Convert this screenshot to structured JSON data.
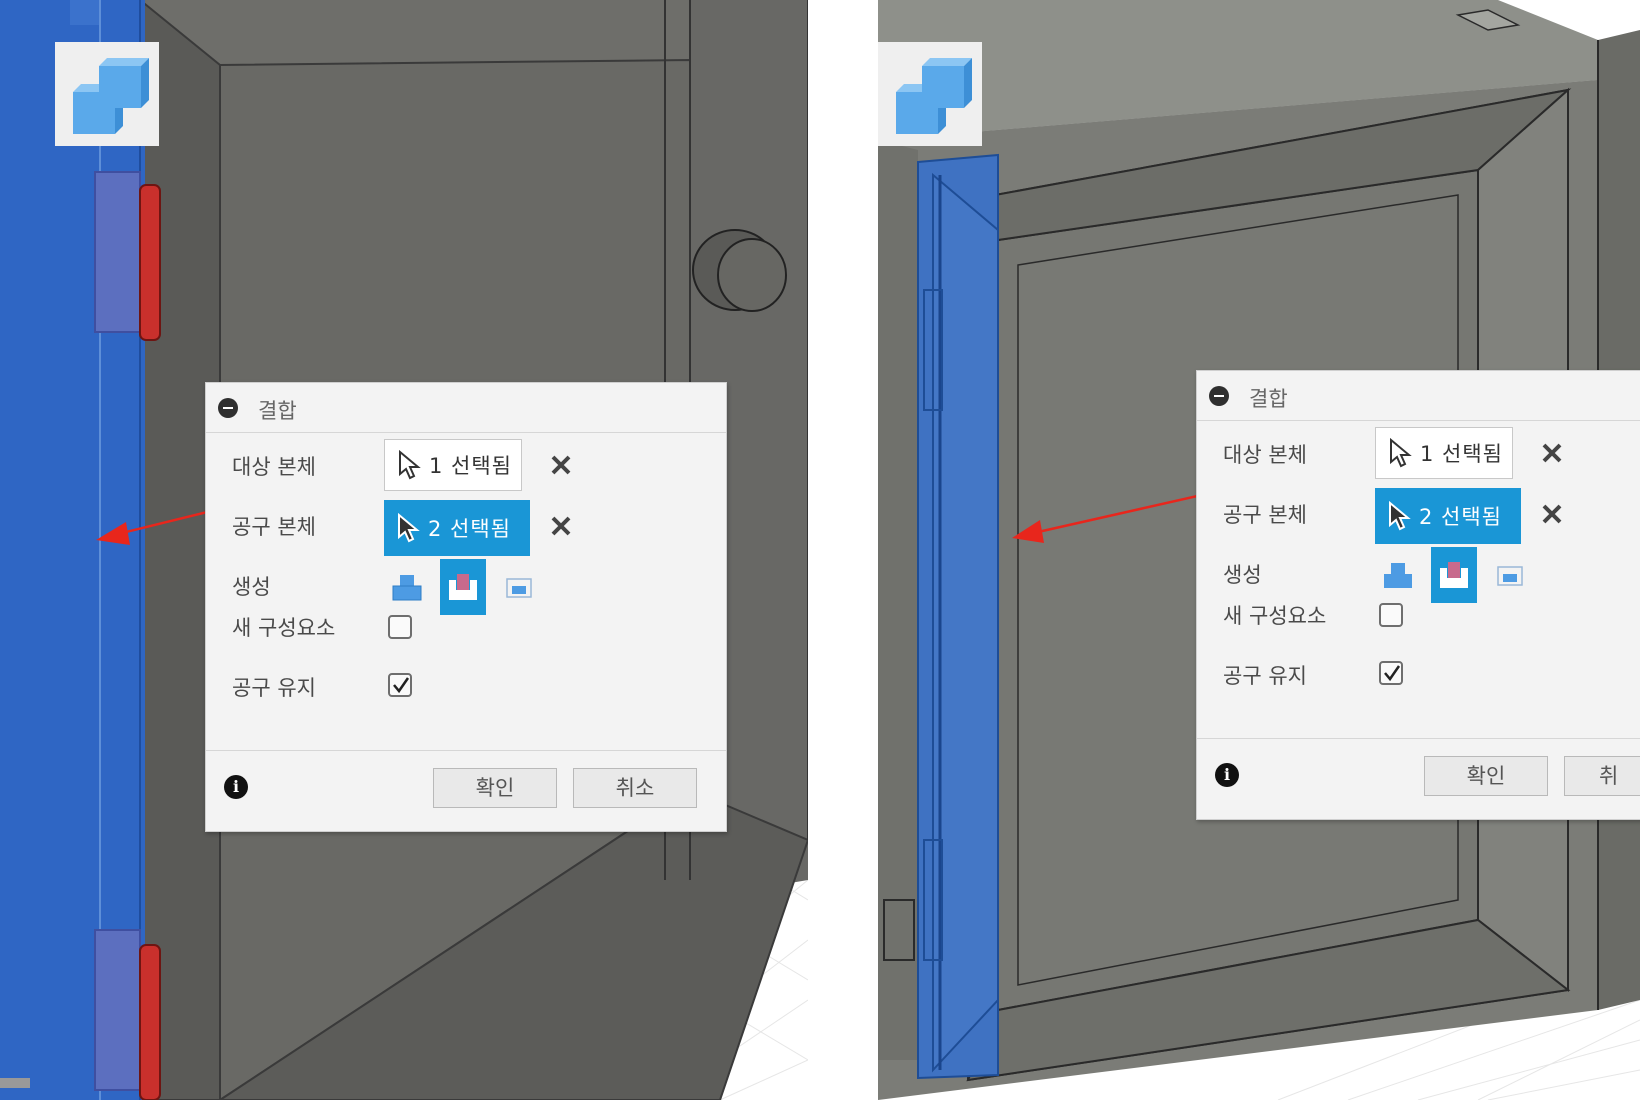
{
  "colors": {
    "accent": "#1a96d6",
    "selected_body": "#2f66c4",
    "arrow": "#e8261c",
    "hinge": "#c9302c",
    "door_gray": "#6b6b67"
  },
  "app_icon": {
    "name": "combine-tool-icon"
  },
  "dialogs": [
    {
      "title": "결합",
      "target_label": "대상 본체",
      "target_value": "1 선택됨",
      "tool_label": "공구 본체",
      "tool_value": "2 선택됨",
      "create_label": "생성",
      "operations": [
        "join-icon",
        "cut-icon",
        "intersect-icon"
      ],
      "active_operation": "cut-icon",
      "new_component_label": "새 구성요소",
      "new_component_checked": false,
      "keep_tools_label": "공구 유지",
      "keep_tools_checked": true,
      "ok_label": "확인",
      "cancel_label": "취소"
    },
    {
      "title": "결합",
      "target_label": "대상 본체",
      "target_value": "1 선택됨",
      "tool_label": "공구 본체",
      "tool_value": "2 선택됨",
      "create_label": "생성",
      "operations": [
        "join-icon",
        "cut-icon",
        "intersect-icon"
      ],
      "active_operation": "cut-icon",
      "new_component_label": "새 구성요소",
      "new_component_checked": false,
      "keep_tools_label": "공구 유지",
      "keep_tools_checked": true,
      "ok_label": "확인",
      "cancel_label": "취"
    }
  ]
}
